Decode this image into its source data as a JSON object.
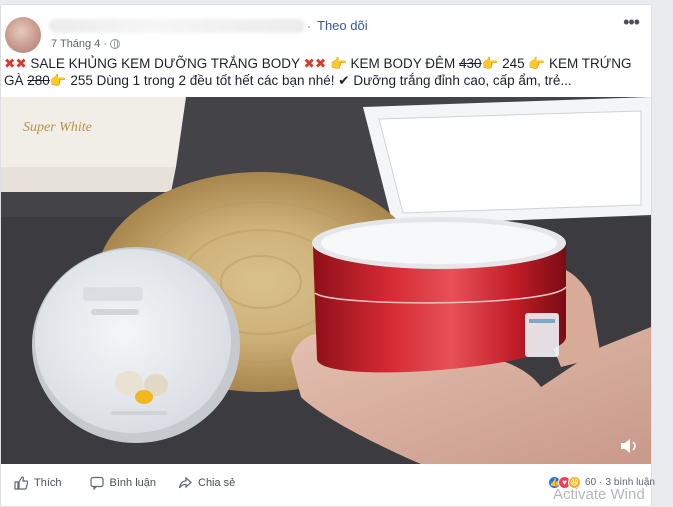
{
  "post": {
    "author_blurred": true,
    "separator": "·",
    "follow_label": "Theo dõi",
    "date": "7 Tháng 4 ·",
    "text_parts": {
      "x1": "✖",
      "x2": "✖",
      "sale": " SALE KHỦNG KEM DƯỠNG TRẮNG BODY ",
      "x3": "✖",
      "x4": "✖",
      "hand1": "👉",
      "body_label": " KEM BODY ĐÊM ",
      "old_price_1": "430",
      "hand2": "👉",
      "new_price_1": " 245 ",
      "hand3": "👉",
      "egg_label": " KEM TRỨNG GÀ ",
      "old_price_2": "280",
      "hand4": "👉",
      "rest": " 255 Dùng 1 trong 2 đều tốt hết các bạn nhé! ✔ Dưỡng trắng đỉnh cao, cấp ẩm, trẻ..."
    }
  },
  "media": {
    "box_brand_text": "Super White",
    "volume_icon": "volume-icon"
  },
  "actions": {
    "like_label": "Thích",
    "comment_label": "Bình luận",
    "share_label": "Chia sẻ"
  },
  "reactions": {
    "count": "60",
    "separator": "·",
    "comments": "3 bình luận"
  },
  "watermark": "Activate Wind",
  "colors": {
    "link": "#385898",
    "jar_red": "#c8202c",
    "background": "#e9ebee"
  }
}
